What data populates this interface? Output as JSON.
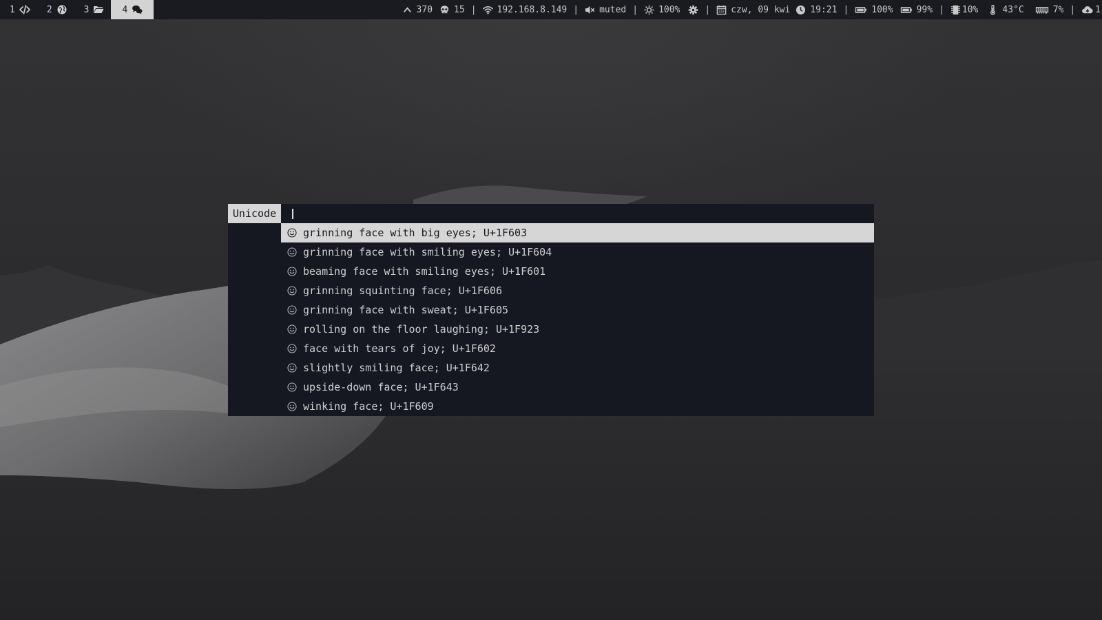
{
  "colors": {
    "bar_bg": "#1a1b21",
    "launcher_bg": "#151821",
    "highlight": "#d6d6d6",
    "text": "#d0d0d0"
  },
  "topbar": {
    "workspaces": [
      {
        "number": "1",
        "icon": "code-icon",
        "active": false
      },
      {
        "number": "2",
        "icon": "globe-icon",
        "active": false
      },
      {
        "number": "3",
        "icon": "folder-icon",
        "active": false
      },
      {
        "number": "4",
        "icon": "chat-icon",
        "active": true
      }
    ],
    "status": {
      "updates": "370",
      "zombies": "15",
      "ip": "192.168.8.149",
      "volume": "muted",
      "brightness": "100%",
      "date": "czw, 09 kwi",
      "time": "19:21",
      "battery1": "100%",
      "battery2": "99%",
      "cpu": "10%",
      "temperature": "43°C",
      "memory": "7%",
      "cloud": "1"
    }
  },
  "launcher": {
    "mode_label": "Unicode",
    "input_value": "",
    "results": [
      {
        "icon": "grinning-face-big-eyes-icon",
        "text": "grinning face with big eyes; U+1F603",
        "selected": true
      },
      {
        "icon": "grinning-face-smiling-eyes-icon",
        "text": "grinning face with smiling eyes; U+1F604",
        "selected": false
      },
      {
        "icon": "beaming-face-icon",
        "text": "beaming face with smiling eyes; U+1F601",
        "selected": false
      },
      {
        "icon": "grinning-squinting-face-icon",
        "text": "grinning squinting face; U+1F606",
        "selected": false
      },
      {
        "icon": "grinning-face-sweat-icon",
        "text": "grinning face with sweat; U+1F605",
        "selected": false
      },
      {
        "icon": "rolling-on-floor-laughing-icon",
        "text": "rolling on the floor laughing; U+1F923",
        "selected": false
      },
      {
        "icon": "face-tears-of-joy-icon",
        "text": "face with tears of joy; U+1F602",
        "selected": false
      },
      {
        "icon": "slightly-smiling-face-icon",
        "text": "slightly smiling face; U+1F642",
        "selected": false
      },
      {
        "icon": "upside-down-face-icon",
        "text": "upside-down face; U+1F643",
        "selected": false
      },
      {
        "icon": "winking-face-icon",
        "text": "winking face; U+1F609",
        "selected": false
      }
    ]
  }
}
